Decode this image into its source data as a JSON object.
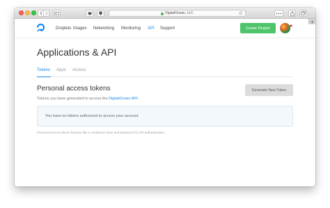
{
  "browser": {
    "url": "DigitalOcean, LLC"
  },
  "nav": {
    "links": [
      "Droplets",
      "Images",
      "Networking",
      "Monitoring",
      "API",
      "Support"
    ],
    "active": "API",
    "create_label": "Create Droplet"
  },
  "page": {
    "title": "Applications & API",
    "tabs": [
      "Tokens",
      "Apps",
      "Access"
    ],
    "active_tab": "Tokens"
  },
  "section": {
    "title": "Personal access tokens",
    "desc_prefix": "Tokens you have generated to access the ",
    "desc_link": "DigitalOcean API",
    "desc_suffix": ".",
    "button_label": "Generate New Token",
    "empty_message": "You have no tokens authorized to access your account.",
    "footnote": "Personal access tokens function like a combined name and password for API authentication."
  },
  "colors": {
    "accent": "#1e88e5",
    "create_button": "#4ec56a",
    "generate_button": "#dcdcdc",
    "empty_box_bg": "#f3f8fd"
  }
}
